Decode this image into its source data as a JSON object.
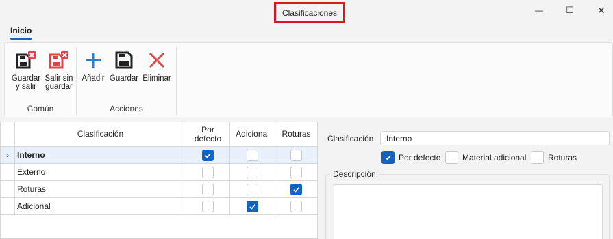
{
  "window": {
    "title": "Clasificaciones",
    "minimize_glyph": "—",
    "maximize_glyph": "☐",
    "close_glyph": "✕"
  },
  "menu": {
    "tabs": [
      {
        "label": "Inicio",
        "active": true
      }
    ]
  },
  "ribbon": {
    "groups": [
      {
        "label": "Común",
        "buttons": [
          {
            "label_line1": "Guardar",
            "label_line2": "y salir",
            "icon": "save-close-icon"
          },
          {
            "label_line1": "Salir sin",
            "label_line2": "guardar",
            "icon": "exit-without-save-icon"
          }
        ]
      },
      {
        "label": "Acciones",
        "buttons": [
          {
            "label_line1": "Añadir",
            "icon": "plus-icon"
          },
          {
            "label_line1": "Guardar",
            "icon": "save-icon"
          },
          {
            "label_line1": "Eliminar",
            "icon": "delete-x-icon"
          }
        ]
      }
    ]
  },
  "grid": {
    "columns": [
      {
        "label": "Clasificación"
      },
      {
        "label_line1": "Por",
        "label_line2": "defecto"
      },
      {
        "label": "Adicional"
      },
      {
        "label": "Roturas"
      }
    ],
    "current_row_indicator": "›",
    "rows": [
      {
        "name": "Interno",
        "por_defecto": true,
        "adicional": false,
        "roturas": false,
        "selected": true
      },
      {
        "name": "Externo",
        "por_defecto": false,
        "adicional": false,
        "roturas": false,
        "selected": false
      },
      {
        "name": "Roturas",
        "por_defecto": false,
        "adicional": false,
        "roturas": true,
        "selected": false
      },
      {
        "name": "Adicional",
        "por_defecto": false,
        "adicional": true,
        "roturas": false,
        "selected": false
      }
    ]
  },
  "detail": {
    "clasificacion_label": "Clasificación",
    "clasificacion_value": "Interno",
    "checkboxes": [
      {
        "label": "Por defecto",
        "checked": true
      },
      {
        "label": "Material adicional",
        "checked": false
      },
      {
        "label": "Roturas",
        "checked": false
      }
    ],
    "descripcion_label": "Descripción",
    "descripcion_value": ""
  },
  "colors": {
    "accent": "#1462c0",
    "highlight_border": "#e0141b",
    "delete_red": "#e04545",
    "add_blue": "#2c7fc7",
    "selected_row": "#e8f0fb"
  }
}
